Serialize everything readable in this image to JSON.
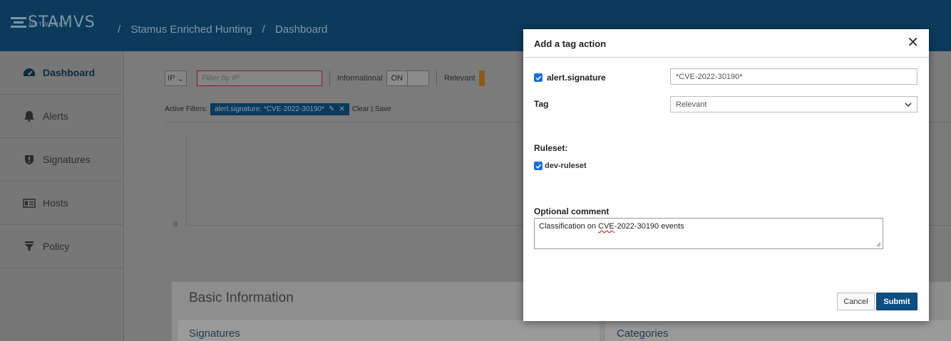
{
  "header": {
    "logo_text": "STAMVS",
    "logo_subtext": "NETWORKS",
    "breadcrumb": [
      "Stamus Enriched Hunting",
      "Dashboard"
    ],
    "separator": "/"
  },
  "sidebar": {
    "items": [
      {
        "label": "Dashboard",
        "icon": "tachometer-icon",
        "active": true
      },
      {
        "label": "Alerts",
        "icon": "bell-icon"
      },
      {
        "label": "Signatures",
        "icon": "shield-icon"
      },
      {
        "label": "Hosts",
        "icon": "id-card-icon"
      },
      {
        "label": "Policy",
        "icon": "filter-icon"
      }
    ]
  },
  "toolbar": {
    "ip_select": "IP",
    "filter_placeholder": "Filter by IP",
    "informational_label": "Informational",
    "informational_switch": "ON",
    "relevant_label": "Relevant"
  },
  "active_filters": {
    "label": "Active Filters:",
    "tag": "alert.signature: *CVE-2022-30190*",
    "clear": "Clear",
    "save": "Save"
  },
  "chart": {
    "zero_label": "0"
  },
  "basic_info": {
    "title": "Basic Information",
    "signatures": "Signatures",
    "categories": "Categories"
  },
  "modal": {
    "title": "Add a tag action",
    "close": "✕",
    "field_label": "alert.signature",
    "field_value": "*CVE-2022-30190*",
    "tag_label": "Tag",
    "tag_value": "Relevant",
    "ruleset_label": "Ruleset:",
    "ruleset_item": "dev-ruleset",
    "comment_label": "Optional comment",
    "comment_prefix": "Classification on ",
    "comment_word": "CVE",
    "comment_suffix": "-2022-30190 events",
    "cancel": "Cancel",
    "submit": "Submit"
  },
  "colors": {
    "topbar": "#0b3a5b",
    "accent": "#0b4f82",
    "checkbox": "#1a6fd6"
  }
}
